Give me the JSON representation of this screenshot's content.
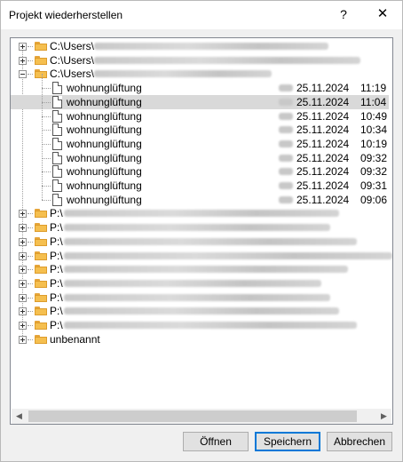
{
  "dialog": {
    "title": "Projekt wiederherstellen",
    "help_label": "?",
    "close_label": "✕"
  },
  "tree": {
    "root_items": [
      {
        "prefix": "C:\\Users\\",
        "label": "C:\\Users\\",
        "expanded": false
      },
      {
        "prefix": "C:\\Users\\",
        "label": "C:\\Users\\",
        "expanded": false
      },
      {
        "prefix": "C:\\Users\\",
        "label": "C:\\Users\\",
        "expanded": true
      }
    ],
    "children": [
      {
        "name": "wohnunglüftung",
        "date": "25.11.2024",
        "time": "11:19",
        "selected": false
      },
      {
        "name": "wohnunglüftung",
        "date": "25.11.2024",
        "time": "11:04",
        "selected": true
      },
      {
        "name": "wohnunglüftung",
        "date": "25.11.2024",
        "time": "10:49",
        "selected": false
      },
      {
        "name": "wohnunglüftung",
        "date": "25.11.2024",
        "time": "10:34",
        "selected": false
      },
      {
        "name": "wohnunglüftung",
        "date": "25.11.2024",
        "time": "10:19",
        "selected": false
      },
      {
        "name": "wohnunglüftung",
        "date": "25.11.2024",
        "time": "09:32",
        "selected": false
      },
      {
        "name": "wohnunglüftung",
        "date": "25.11.2024",
        "time": "09:32",
        "selected": false
      },
      {
        "name": "wohnunglüftung",
        "date": "25.11.2024",
        "time": "09:31",
        "selected": false
      },
      {
        "name": "wohnunglüftung",
        "date": "25.11.2024",
        "time": "09:06",
        "selected": false
      }
    ],
    "p_items": [
      {
        "label": "P:\\"
      },
      {
        "label": "P:\\"
      },
      {
        "label": "P:\\"
      },
      {
        "label": "P:\\"
      },
      {
        "label": "P:\\"
      },
      {
        "label": "P:\\"
      },
      {
        "label": "P:\\"
      },
      {
        "label": "P:\\"
      },
      {
        "label": "P:\\"
      }
    ],
    "last_item": {
      "label": "unbenannt"
    }
  },
  "buttons": {
    "open": "Öffnen",
    "save": "Speichern",
    "cancel": "Abbrechen"
  },
  "icons": {
    "folder": "folder-icon",
    "document": "document-icon",
    "expand": "expand-icon",
    "collapse": "collapse-icon"
  },
  "colors": {
    "folder": "#f5bf4f",
    "selection": "#d9d9d9",
    "default_button_border": "#0078d7"
  }
}
